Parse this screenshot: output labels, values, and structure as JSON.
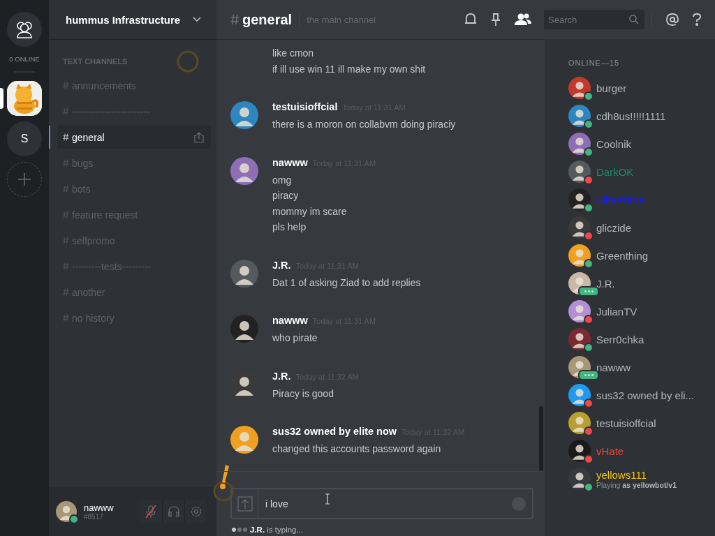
{
  "server_rail": {
    "online_count": "0 ONLINE",
    "servers": [
      {
        "kind": "picture",
        "selected": true
      },
      {
        "kind": "initial",
        "label": "S",
        "selected": false
      }
    ]
  },
  "server": {
    "name": "hummus Infrastructure"
  },
  "channel_category": "TEXT CHANNELS",
  "channels": [
    {
      "name": "annuncements",
      "selected": false
    },
    {
      "name": "------------------------",
      "selected": false
    },
    {
      "name": "general",
      "selected": true
    },
    {
      "name": "bugs",
      "selected": false
    },
    {
      "name": "bots",
      "selected": false
    },
    {
      "name": "feature request",
      "selected": false
    },
    {
      "name": "selfpromo",
      "selected": false
    },
    {
      "name": "---------tests---------",
      "selected": false
    },
    {
      "name": "another",
      "selected": false
    },
    {
      "name": "no history",
      "selected": false
    }
  ],
  "user": {
    "name": "nawww",
    "tag": "#8517",
    "do_not_disturb": false,
    "muted": true
  },
  "chat_header": {
    "channel": "general",
    "topic": "the main channel",
    "search_placeholder": "Search"
  },
  "messages": [
    {
      "lines": [
        "like cmon",
        "if ill use win 11 ill make my own shit"
      ]
    },
    {
      "author": "testuisioffcial",
      "time": "Today at 11:31 AM",
      "lines": [
        "there is a moron on collabvm doing piraciy"
      ]
    },
    {
      "author": "nawww",
      "time": "Today at 11:31 AM",
      "lines": [
        "omg",
        "piracy",
        "mommy im scare",
        "pls help"
      ]
    },
    {
      "author": "J.R.",
      "time": "Today at 11:31 AM",
      "lines": [
        "Dat 1 of asking Ziad to add replies"
      ]
    },
    {
      "author": "nawww",
      "time": "Today at 11:31 AM",
      "lines": [
        "who pirate"
      ]
    },
    {
      "author": "J.R.",
      "time": "Today at 11:32 AM",
      "lines": [
        "Piracy is good"
      ]
    },
    {
      "author": "sus32 owned by elite now",
      "time": "Today at 11:32 AM",
      "lines": [
        "changed this accounts password again"
      ]
    }
  ],
  "composer": {
    "value": "i love"
  },
  "typing": "**J.R.** is typing...",
  "members_header": "ONLINE—15",
  "members": [
    {
      "name": "burger",
      "do_not_disturb": false,
      "typing": false
    },
    {
      "name": "cdh8us!!!!!1111",
      "do_not_disturb": false,
      "typing": false
    },
    {
      "name": "Coolnik",
      "do_not_disturb": false,
      "typing": false
    },
    {
      "name": "DarkOK",
      "do_not_disturb": true,
      "typing": false,
      "color": "#1f8b6c"
    },
    {
      "name": "ElitePrime",
      "do_not_disturb": false,
      "typing": false,
      "color": "#1a1aff"
    },
    {
      "name": "gliczide",
      "do_not_disturb": true,
      "typing": false
    },
    {
      "name": "Greenthing",
      "do_not_disturb": false,
      "typing": false
    },
    {
      "name": "J.R.",
      "do_not_disturb": false,
      "typing": true
    },
    {
      "name": "JulianTV",
      "do_not_disturb": true,
      "typing": false
    },
    {
      "name": "Serr0chka",
      "do_not_disturb": false,
      "typing": false
    },
    {
      "name": "nawww",
      "do_not_disturb": false,
      "typing": true
    },
    {
      "name": "sus32 owned by eli...",
      "do_not_disturb": true,
      "typing": false
    },
    {
      "name": "testuisioffcial",
      "do_not_disturb": true,
      "typing": false
    },
    {
      "name": "vHate",
      "do_not_disturb": true,
      "typing": false,
      "color": "#e74c3c"
    },
    {
      "name": "yellows111",
      "do_not_disturb": false,
      "typing": false,
      "color": "#f1c40f",
      "activity": "Playing **as yellowbot/v1**"
    }
  ]
}
